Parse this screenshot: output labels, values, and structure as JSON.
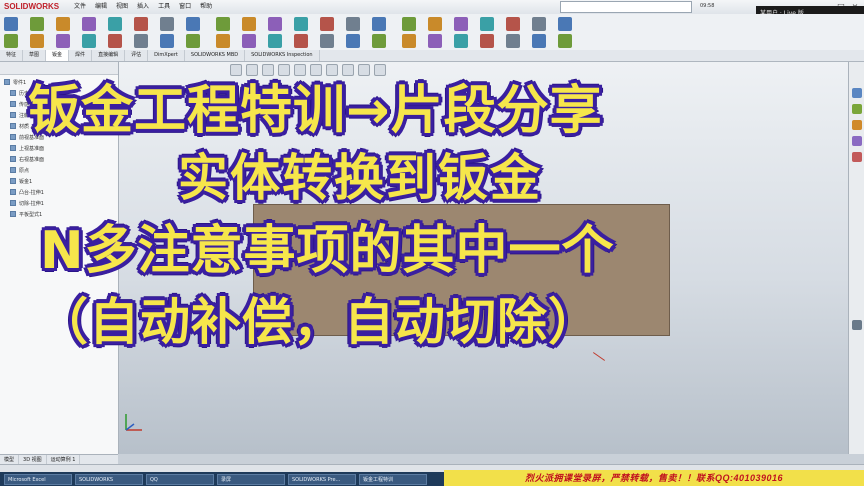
{
  "app": {
    "logo_text": "SOLIDWORKS",
    "menu": [
      "文件",
      "编辑",
      "视图",
      "插入",
      "工具",
      "窗口",
      "帮助"
    ],
    "time": "09:58",
    "user_label": "某用户 · Live 版"
  },
  "command_tabs": [
    "特征",
    "草图",
    "钣金",
    "焊件",
    "直接编辑",
    "评估",
    "DimXpert",
    "SOLIDWORKS MBD",
    "SOLIDWORKS Inspection"
  ],
  "active_tab_index": 2,
  "tree": {
    "items": [
      "零件1",
      "历史",
      "传感器",
      "注解",
      "材质 <未指定>",
      "前视基准面",
      "上视基准面",
      "右视基准面",
      "原点",
      "钣金1",
      "凸台-拉伸1",
      "切除-拉伸1",
      "平板型式1"
    ]
  },
  "panel_tabs": [
    "模型",
    "3D 视图",
    "运动算例 1"
  ],
  "taskbar": [
    "Microsoft Excel",
    "SOLIDWORKS",
    "QQ",
    "录屏",
    "SOLIDWORKS Pre...",
    "钣金工程特训"
  ],
  "banner": "烈火派拥课堂录屏，严禁转载，售卖！！联系QQ:401039016",
  "overlay": {
    "line1": "钣金工程特训→片段分享",
    "line2": "实体转换到钣金",
    "line3": "N多注意事项的其中一个",
    "line4": "（自动补偿，自动切除）"
  },
  "colors": {
    "overlay_fill": "#f6e64b",
    "overlay_outline": "#3a1fa0",
    "part": "#9c8770"
  }
}
